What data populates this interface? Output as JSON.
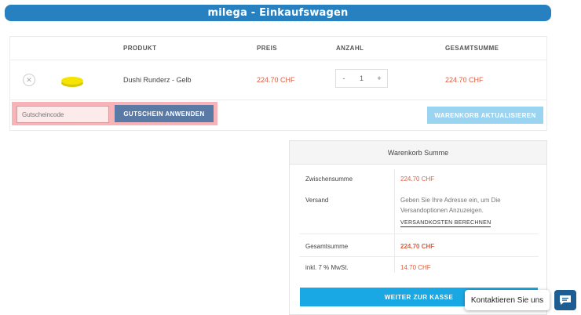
{
  "header": {
    "title": "milega - Einkaufswagen"
  },
  "cart": {
    "columns": {
      "product": "PRODUKT",
      "price": "PREIS",
      "quantity": "ANZAHL",
      "total": "GESAMTSUMME"
    },
    "items": [
      {
        "name": "Dushi Runderz - Gelb",
        "price": "224.70 CHF",
        "quantity": "1",
        "subtotal": "224.70 CHF",
        "thumb_color": "#f5e400"
      }
    ],
    "remove_icon": "close-icon",
    "qty_minus": "-",
    "qty_plus": "+"
  },
  "coupon": {
    "placeholder": "Gutscheincode",
    "apply_label": "GUTSCHEIN ANWENDEN",
    "highlight_color": "#f7b3b7"
  },
  "update_label": "WARENKORB AKTUALISIEREN",
  "totals": {
    "heading": "Warenkorb Summe",
    "subtotal_label": "Zwischensumme",
    "subtotal_value": "224.70 CHF",
    "shipping_label": "Versand",
    "shipping_text": "Geben Sie Ihre Adresse ein, um Die Versandoptionen Anzuzeigen.",
    "shipping_link": "VERSANDKOSTEN BERECHNEN",
    "total_label": "Gesamtsumme",
    "total_value": "224.70 CHF",
    "tax_label": "inkl. 7 % MwSt.",
    "tax_value": "14.70 CHF",
    "checkout_label": "WEITER ZUR KASSE"
  },
  "chat": {
    "label": "Kontaktieren Sie uns",
    "icon": "chat-icon"
  },
  "colors": {
    "brand": "#2780c0",
    "accent": "#e45b3a",
    "checkout": "#1aa8e4"
  }
}
